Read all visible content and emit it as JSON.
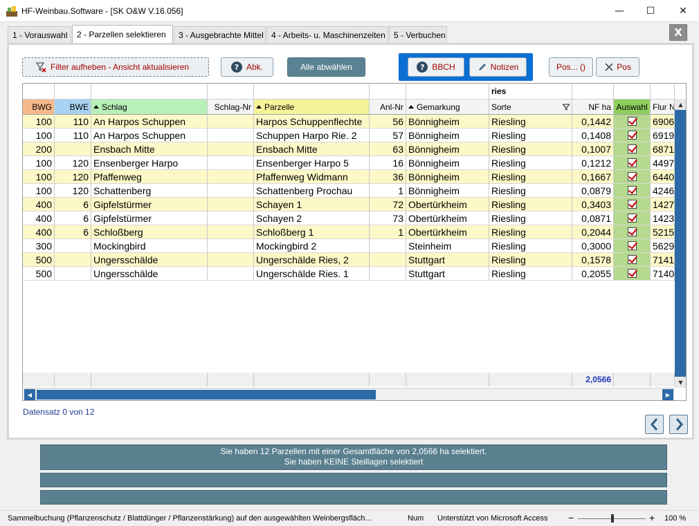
{
  "window": {
    "title": "HF-Weinbau.Software - [SK O&W V.16.056]",
    "minimize_glyph": "—",
    "maximize_glyph": "☐",
    "close_glyph": "✕"
  },
  "tabs": [
    {
      "label": "1 - Vorauswahl",
      "active": false
    },
    {
      "label": "2 - Parzellen selektieren",
      "active": true
    },
    {
      "label": "3 - Ausgebrachte Mittel",
      "active": false
    },
    {
      "label": "4 - Arbeits- u. Maschinenzeiten",
      "active": false
    },
    {
      "label": "5 - Verbuchen",
      "active": false
    }
  ],
  "close_form_label": "X",
  "toolbar": {
    "filter_label": "Filter aufheben - Ansicht aktualisieren",
    "abk_label": "Abk.",
    "alle_label": "Alle abwählen",
    "bbch_label": "BBCH",
    "notizen_label": "Notizen",
    "pos1_label": "Pos... ()",
    "pos2_label": "Pos"
  },
  "grid": {
    "filter_value_sorte": "ries",
    "columns": [
      {
        "key": "bwg",
        "label": "BWG",
        "color": "#f7b98b"
      },
      {
        "key": "bwe",
        "label": "BWE",
        "color": "#a9d2f2"
      },
      {
        "key": "schlag",
        "label": "Schlag",
        "color": "#b8f0b8",
        "sorted": true
      },
      {
        "key": "schlag_nr",
        "label": "Schlag-Nr"
      },
      {
        "key": "parzelle",
        "label": "Parzelle",
        "color": "#f7f39a",
        "sorted": true
      },
      {
        "key": "anl_nr",
        "label": "Anl-Nr"
      },
      {
        "key": "gemarkung",
        "label": "Gemarkung",
        "sorted": true
      },
      {
        "key": "sorte",
        "label": "Sorte",
        "filtered": true
      },
      {
        "key": "nf_ha",
        "label": "NF ha"
      },
      {
        "key": "auswahl",
        "label": "Auswahl",
        "color": "#8fcf5f"
      },
      {
        "key": "flur_n",
        "label": "Flur N"
      }
    ],
    "rows": [
      {
        "bwg": "100",
        "bwe": "110",
        "schlag": "An Harpos Schuppen",
        "schlag_nr": "",
        "parzelle": "Harpos Schuppenflechte",
        "anl_nr": "56",
        "gemarkung": "Bönnigheim",
        "sorte": "Riesling",
        "nf_ha": "0,1442",
        "auswahl": true,
        "flur_n": "6906"
      },
      {
        "bwg": "100",
        "bwe": "110",
        "schlag": "An Harpos Schuppen",
        "schlag_nr": "",
        "parzelle": "Schuppen Harpo Rie. 2",
        "anl_nr": "57",
        "gemarkung": "Bönnigheim",
        "sorte": "Riesling",
        "nf_ha": "0,1408",
        "auswahl": true,
        "flur_n": "6919"
      },
      {
        "bwg": "200",
        "bwe": "",
        "schlag": "Ensbach Mitte",
        "schlag_nr": "",
        "parzelle": "Ensbach Mitte",
        "anl_nr": "63",
        "gemarkung": "Bönnigheim",
        "sorte": "Riesling",
        "nf_ha": "0,1007",
        "auswahl": true,
        "flur_n": "6871"
      },
      {
        "bwg": "100",
        "bwe": "120",
        "schlag": "Ensenberger Harpo",
        "schlag_nr": "",
        "parzelle": "Ensenberger Harpo 5",
        "anl_nr": "16",
        "gemarkung": "Bönnigheim",
        "sorte": "Riesling",
        "nf_ha": "0,1212",
        "auswahl": true,
        "flur_n": "4497"
      },
      {
        "bwg": "100",
        "bwe": "120",
        "schlag": "Pfaffenweg",
        "schlag_nr": "",
        "parzelle": "Pfaffenweg Widmann",
        "anl_nr": "36",
        "gemarkung": "Bönnigheim",
        "sorte": "Riesling",
        "nf_ha": "0,1667",
        "auswahl": true,
        "flur_n": "6440"
      },
      {
        "bwg": "100",
        "bwe": "120",
        "schlag": "Schattenberg",
        "schlag_nr": "",
        "parzelle": "Schattenberg Prochau",
        "anl_nr": "1",
        "gemarkung": "Bönnigheim",
        "sorte": "Riesling",
        "nf_ha": "0,0879",
        "auswahl": true,
        "flur_n": "4246"
      },
      {
        "bwg": "400",
        "bwe": "6",
        "schlag": "Gipfelstürmer",
        "schlag_nr": "",
        "parzelle": "Schayen 1",
        "anl_nr": "72",
        "gemarkung": "Obertürkheim",
        "sorte": "Riesling",
        "nf_ha": "0,3403",
        "auswahl": true,
        "flur_n": "1427"
      },
      {
        "bwg": "400",
        "bwe": "6",
        "schlag": "Gipfelstürmer",
        "schlag_nr": "",
        "parzelle": "Schayen 2",
        "anl_nr": "73",
        "gemarkung": "Obertürkheim",
        "sorte": "Riesling",
        "nf_ha": "0,0871",
        "auswahl": true,
        "flur_n": "1423"
      },
      {
        "bwg": "400",
        "bwe": "6",
        "schlag": "Schloßberg",
        "schlag_nr": "",
        "parzelle": "Schloßberg 1",
        "anl_nr": "1",
        "gemarkung": "Obertürkheim",
        "sorte": "Riesling",
        "nf_ha": "0,2044",
        "auswahl": true,
        "flur_n": "5215"
      },
      {
        "bwg": "300",
        "bwe": "",
        "schlag": "Mockingbird",
        "schlag_nr": "",
        "parzelle": "Mockingbird 2",
        "anl_nr": "",
        "gemarkung": "Steinheim",
        "sorte": "Riesling",
        "nf_ha": "0,3000",
        "auswahl": true,
        "flur_n": "5629"
      },
      {
        "bwg": "500",
        "bwe": "",
        "schlag": "Ungersschälde",
        "schlag_nr": "",
        "parzelle": "Ungerschälde Ries, 2",
        "anl_nr": "",
        "gemarkung": "Stuttgart",
        "sorte": "Riesling",
        "nf_ha": "0,1578",
        "auswahl": true,
        "flur_n": "7141"
      },
      {
        "bwg": "500",
        "bwe": "",
        "schlag": "Ungersschälde",
        "schlag_nr": "",
        "parzelle": "Ungerschälde Ries. 1",
        "anl_nr": "",
        "gemarkung": "Stuttgart",
        "sorte": "Riesling",
        "nf_ha": "0,2055",
        "auswahl": true,
        "flur_n": "7140"
      }
    ],
    "total_nf_ha": "2,0566"
  },
  "datensatz_label": "Datensatz 0 von 12",
  "messages": {
    "line1": "Sie haben 12 Parzellen mit einer Gesamtfläche von 2,0566 ha selektiert.",
    "line2": "Sie haben KEINE Steillagen selektiert",
    "line3": "",
    "line4": ""
  },
  "statusbar": {
    "left": "Sammelbuchung (Pflanzenschutz / Blattdünger / Pflanzenstärkung) auf den ausgewählten Weinbergsfläch...",
    "num": "Num",
    "access": "Unterstützt von Microsoft Access",
    "zoom_minus": "−",
    "zoom_plus": "+",
    "zoom": "100 %"
  }
}
